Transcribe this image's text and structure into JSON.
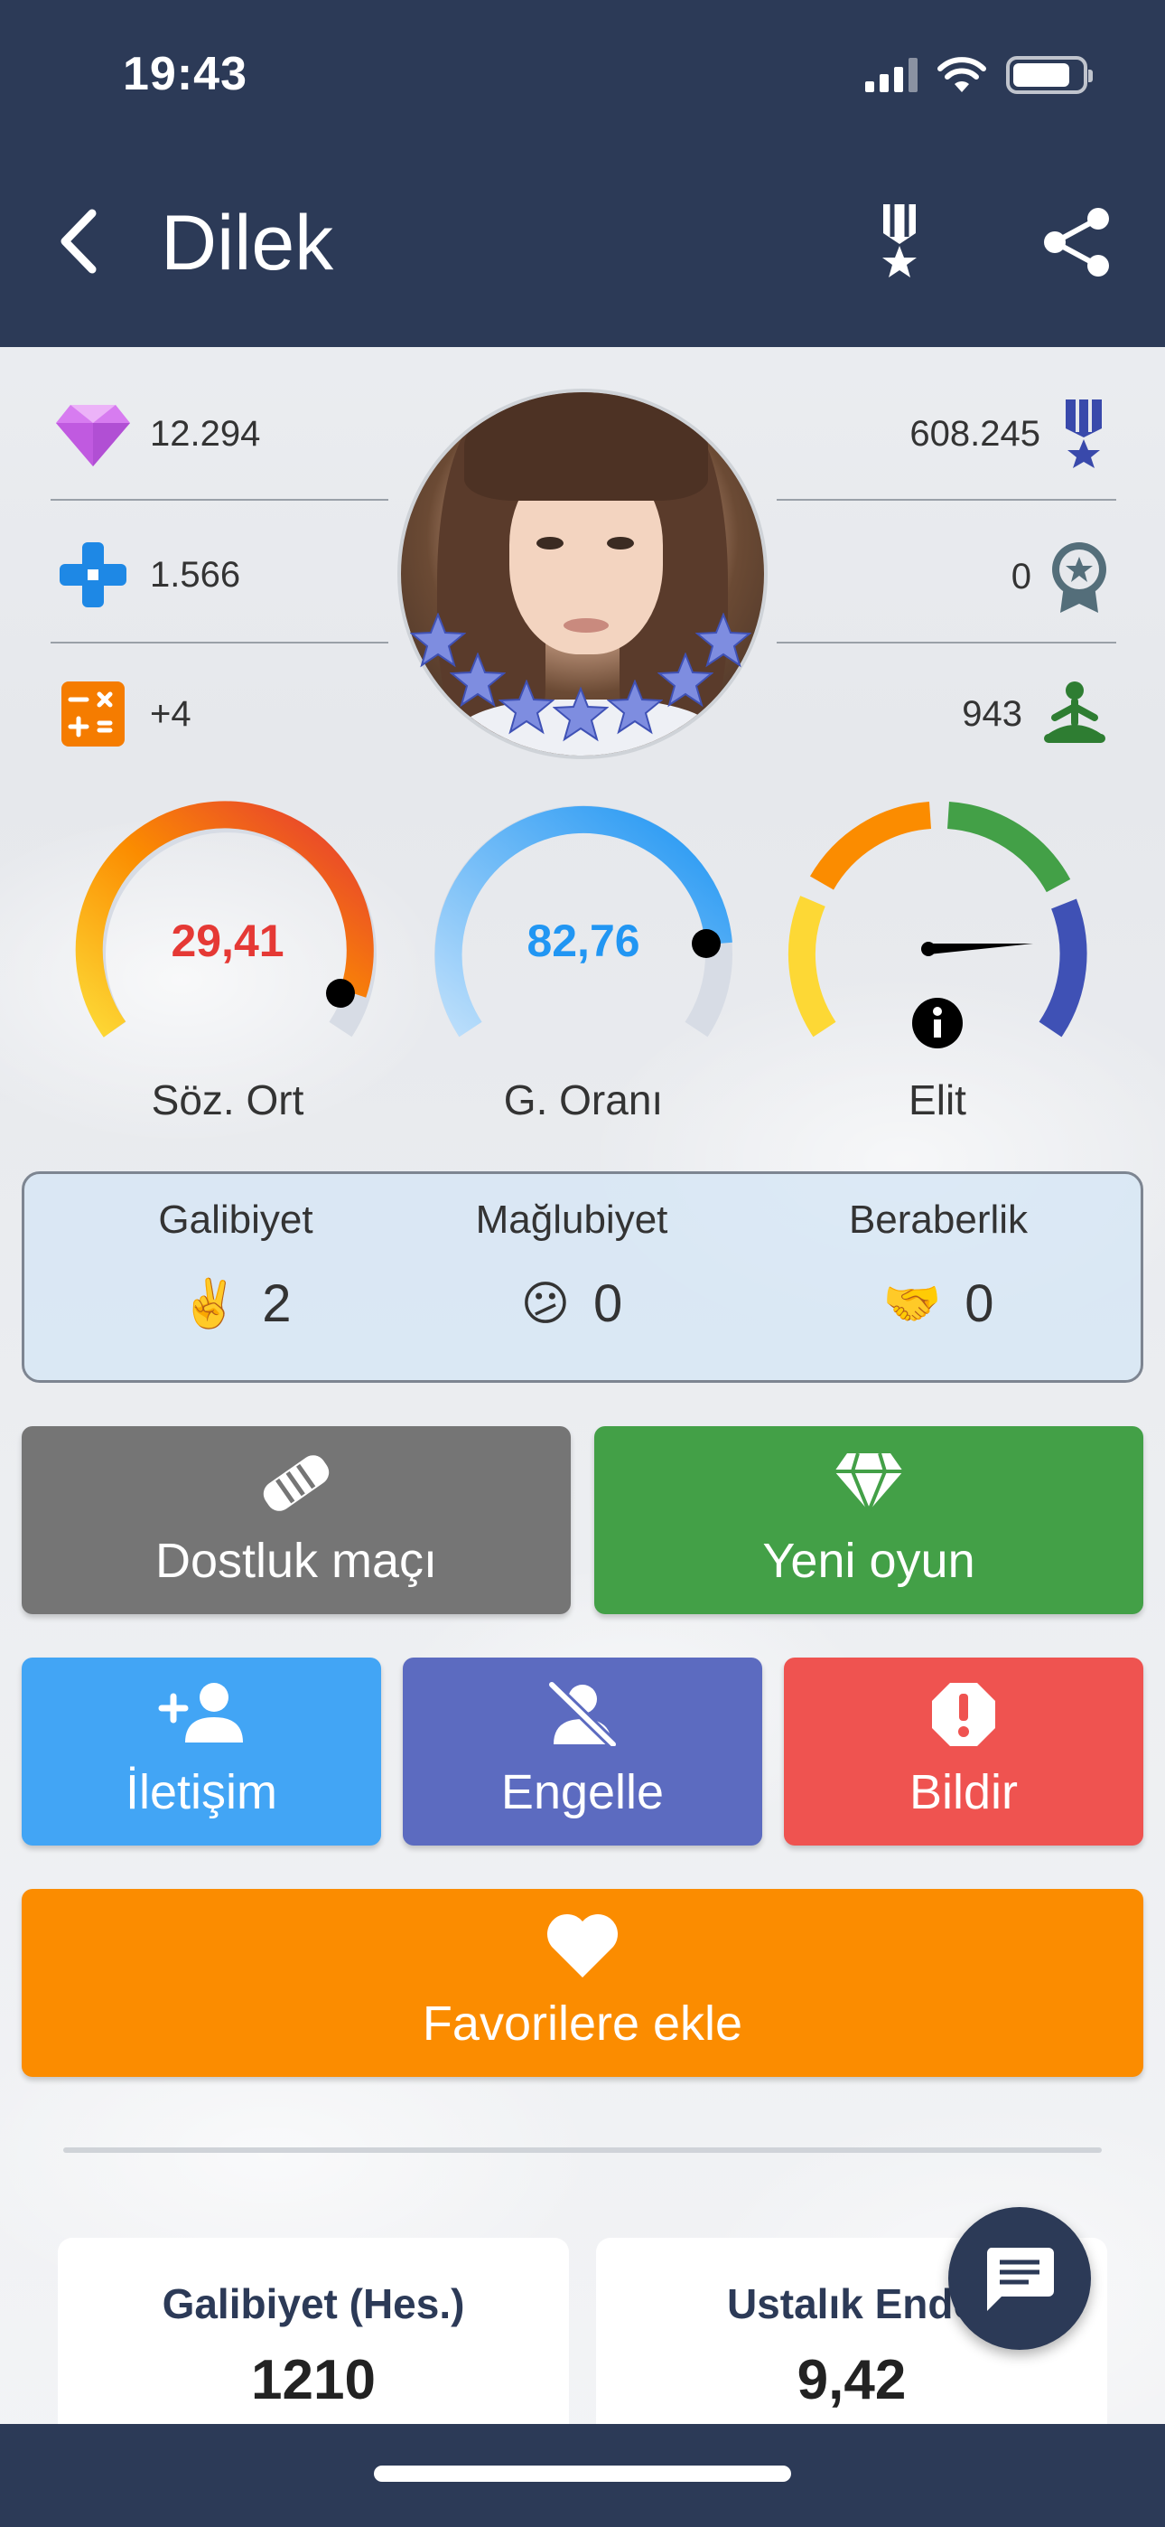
{
  "status": {
    "time": "19:43"
  },
  "header": {
    "title": "Dilek"
  },
  "stats_left": [
    {
      "icon": "diamond-icon",
      "value": "12.294"
    },
    {
      "icon": "game-controller-icon",
      "value": "1.566"
    },
    {
      "icon": "calculator-icon",
      "value": "+4"
    }
  ],
  "stats_right": [
    {
      "icon": "medal-icon",
      "value": "608.245"
    },
    {
      "icon": "award-ribbon-icon",
      "value": "0"
    },
    {
      "icon": "meditation-icon",
      "value": "943"
    }
  ],
  "gauges": [
    {
      "value": "29,41",
      "label": "Söz. Ort",
      "color": "#e53935"
    },
    {
      "value": "82,76",
      "label": "G. Oranı",
      "color": "#2196f3"
    },
    {
      "value": "",
      "label": "Elit",
      "color": "#000000"
    }
  ],
  "results": {
    "win": {
      "label": "Galibiyet",
      "emoji": "✌️",
      "count": "2"
    },
    "loss": {
      "label": "Mağlubiyet",
      "emoji": "😕",
      "count": "0"
    },
    "draw": {
      "label": "Beraberlik",
      "emoji": "🤝",
      "count": "0"
    }
  },
  "buttons": {
    "friendly": {
      "label": "Dostluk maçı",
      "color": "#757575"
    },
    "new_game": {
      "label": "Yeni oyun",
      "color": "#43a047"
    },
    "contact": {
      "label": "İletişim",
      "color": "#42a5f5"
    },
    "block": {
      "label": "Engelle",
      "color": "#5c6bc0"
    },
    "report": {
      "label": "Bildir",
      "color": "#ef5350"
    },
    "favorite": {
      "label": "Favorilere ekle",
      "color": "#fb8c00"
    }
  },
  "cards": [
    {
      "title": "Galibiyet (Hes.)",
      "value": "1210"
    },
    {
      "title": "Ustalık Ende",
      "value": "9,42"
    }
  ]
}
